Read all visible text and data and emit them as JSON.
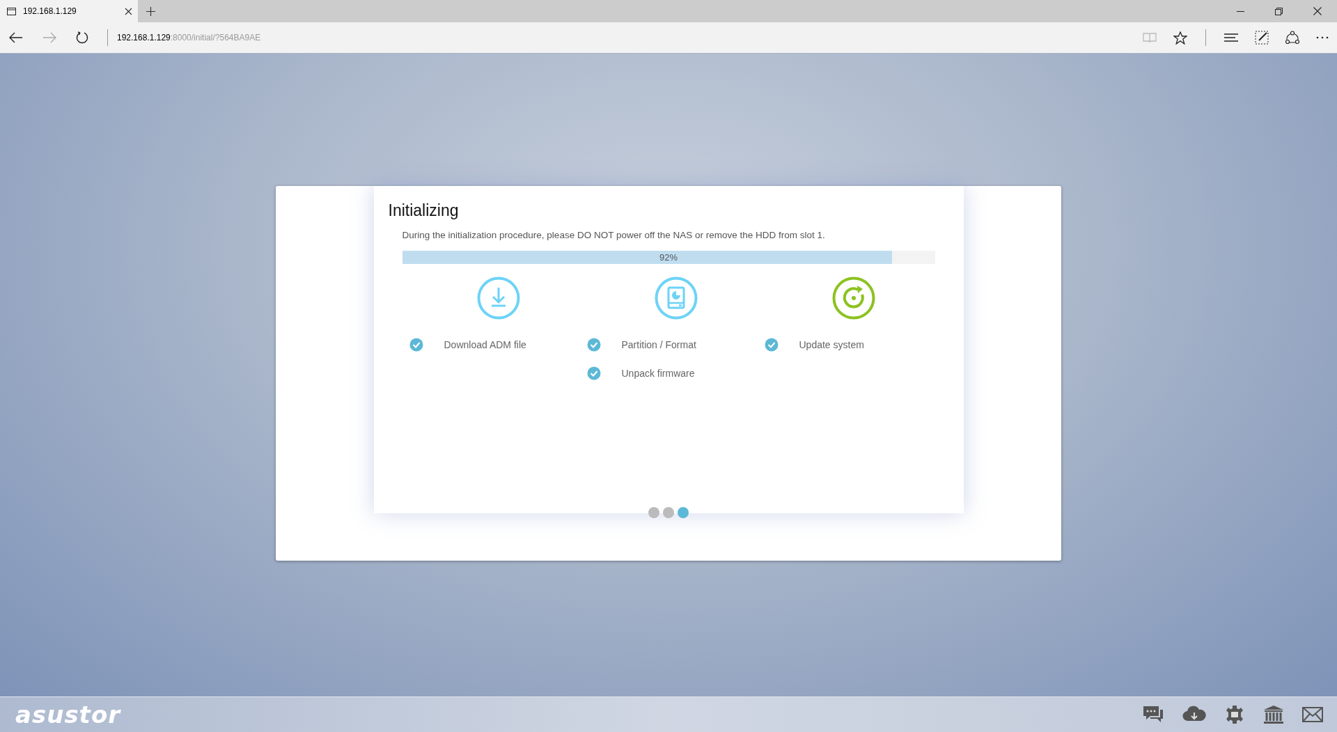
{
  "browser": {
    "tab": {
      "title": "192.168.1.129"
    },
    "address": {
      "host": "192.168.1.129",
      "rest": ":8000/initial/?564BA9AE"
    }
  },
  "dialog": {
    "title": "Initializing",
    "message": "During the initialization procedure, please DO NOT power off the NAS or remove the HDD from slot 1.",
    "progress": {
      "level": 0.92,
      "reading": "92%"
    },
    "steps": [
      {
        "kind": "download",
        "color": "#6dd3f7",
        "tasks": [
          {
            "label": "Download ADM file",
            "done": true
          }
        ]
      },
      {
        "kind": "partition",
        "color": "#6dd3f7",
        "tasks": [
          {
            "label": "Partition / Format",
            "done": true
          },
          {
            "label": "Unpack firmware",
            "done": true
          }
        ]
      },
      {
        "kind": "update",
        "color": "#8cc220",
        "tasks": [
          {
            "label": "Update system",
            "done": true
          }
        ]
      }
    ],
    "pager": [
      {
        "selected": false
      },
      {
        "selected": false
      },
      {
        "selected": true
      }
    ]
  },
  "footer": {
    "logo": "asustor"
  }
}
